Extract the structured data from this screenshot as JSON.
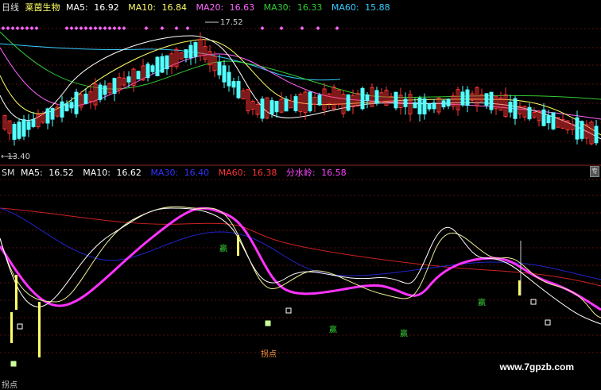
{
  "top_panel": {
    "period_label": "日线",
    "stock_name": "莱茵生物",
    "indicators": [
      {
        "label": "MA5:",
        "value": "16.92",
        "color": "#ffffff"
      },
      {
        "label": "MA10:",
        "value": "16.84",
        "color": "#ffff66"
      },
      {
        "label": "MA20:",
        "value": "16.63",
        "color": "#ff66ff"
      },
      {
        "label": "MA30:",
        "value": "16.33",
        "color": "#33cc33"
      },
      {
        "label": "MA60:",
        "value": "15.88",
        "color": "#33ccff"
      }
    ],
    "high_marker": "17.52",
    "low_marker": "13.40"
  },
  "bottom_panel": {
    "name": "SM",
    "indicators": [
      {
        "label": "MA5:",
        "value": "16.52",
        "color": "#ffffff"
      },
      {
        "label": "MA10:",
        "value": "16.62",
        "color": "#ffff66"
      },
      {
        "label": "MA30:",
        "value": "16.40",
        "color": "#3333ff"
      },
      {
        "label": "MA60:",
        "value": "16.38",
        "color": "#ff3333"
      },
      {
        "label": "分水岭:",
        "value": "16.58",
        "color": "#ff44ff"
      }
    ],
    "signal_labels": [
      "赢",
      "赢",
      "赢",
      "赢"
    ],
    "turning_point_label": "拐点",
    "bottom_left_label": "拐点"
  },
  "watermark": "www.7gpzb.com",
  "colors": {
    "up": "#ff3333",
    "down": "#54ffff",
    "fen_shui_ling": "#ff33ff",
    "signal_yellow": "#ffff66"
  },
  "chart_data": [
    {
      "type": "candlestick",
      "title": "莱茵生物 日线",
      "price_range": [
        13.4,
        17.52
      ],
      "series": [
        {
          "name": "MA5",
          "value": 16.92
        },
        {
          "name": "MA10",
          "value": 16.84
        },
        {
          "name": "MA20",
          "value": 16.63
        },
        {
          "name": "MA30",
          "value": 16.33
        },
        {
          "name": "MA60",
          "value": 15.88
        }
      ]
    },
    {
      "type": "line",
      "title": "SM",
      "series": [
        {
          "name": "MA5",
          "value": 16.52
        },
        {
          "name": "MA10",
          "value": 16.62
        },
        {
          "name": "MA30",
          "value": 16.4
        },
        {
          "name": "MA60",
          "value": 16.38
        },
        {
          "name": "分水岭",
          "value": 16.58
        }
      ]
    }
  ]
}
